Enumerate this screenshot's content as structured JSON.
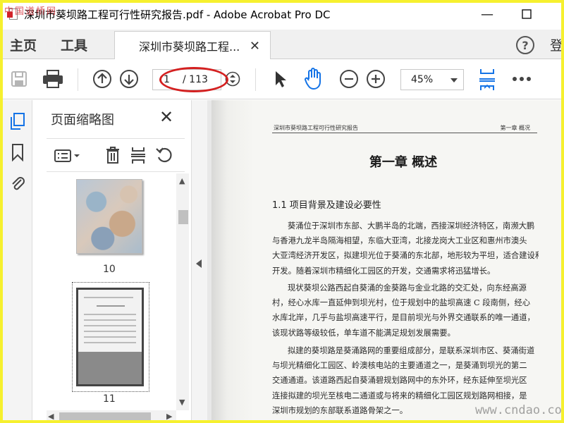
{
  "window": {
    "title": "深圳市葵坝路工程可行性研究报告.pdf - Adobe Acrobat Pro DC",
    "corner_watermark": "中国道桥网"
  },
  "tabs": {
    "home": "主页",
    "tools": "工具",
    "document": "深圳市葵坝路工程...",
    "signin": "登"
  },
  "toolbar": {
    "current_page": "1",
    "total_pages": "/ 113",
    "zoom": "45%",
    "icons": [
      "save-icon",
      "print-icon",
      "prev-page-icon",
      "next-page-icon",
      "page-nav-icon",
      "select-icon",
      "hand-icon",
      "zoom-out-icon",
      "zoom-in-icon",
      "fit-page-icon",
      "more-icon"
    ]
  },
  "thumbnails_panel": {
    "title": "页面缩略图",
    "items": [
      {
        "label": "10"
      },
      {
        "label": "11"
      }
    ]
  },
  "document": {
    "header_left": "深圳市葵坝路工程可行性研究报告",
    "header_right": "第一章  概况",
    "chapter_title": "第一章  概述",
    "section_title": "1.1 项目背景及建设必要性",
    "paragraphs": [
      [
        "葵涌位于深圳市东部、大鹏半岛的北端，西接深圳经济特区，南濒大鹏",
        "与香港九龙半岛隔海相望，东临大亚湾，北接龙岗大工业区和惠州市澳头",
        "大亚湾经济开发区，拟建坝光位于葵涌的东北部，地形较为平坦，适合建设和",
        "开发。随着深圳市精细化工园区的开发，交通需求将迅猛增长。"
      ],
      [
        "现状葵坝公路西起自葵涌的金葵路与金业北路的交汇处，向东经高源",
        "村，经心水库一直延伸到坝光村，位于规划中的盐坝高速 C 段南侧，经心",
        "水库北岸，几乎与盐坝高速平行，是目前坝光与外界交通联系的唯一通道，",
        "该现状路等级较低，单车道不能满足规划发展需要。"
      ],
      [
        "拟建的葵坝路是葵涌路网的重要组成部分，是联系深圳市区、葵涌街道",
        "与坝光精细化工园区、岭澳核电站的主要通道之一，是葵涌到坝光的第二",
        "交通通道。该道路西起自葵涌碧规划路网中的东外环，经东延伸至坝光区",
        "连接拟建的坝光至核电二通道或与将来的精细化工园区规划路网相接，是",
        "深圳市规划的东部联系道路骨架之一。"
      ]
    ],
    "watermark": "www.cndao.com"
  },
  "colors": {
    "frame_border": "#f6f02e",
    "annotation_red": "#d42020",
    "accent_blue": "#1473e6"
  }
}
